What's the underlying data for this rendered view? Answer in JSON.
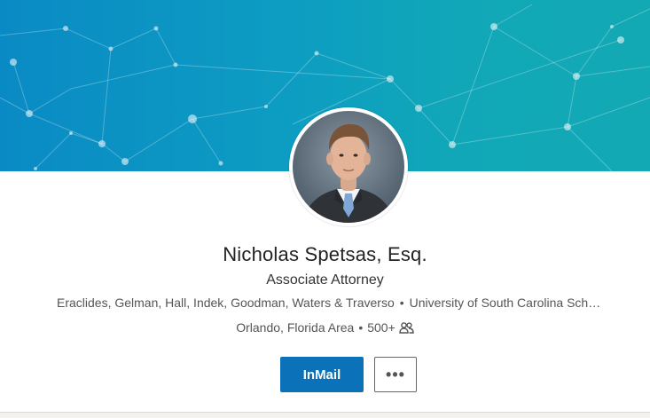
{
  "profile": {
    "name": "Nicholas Spetsas, Esq.",
    "headline": "Associate Attorney",
    "company": "Eraclides, Gelman, Hall, Indek, Goodman, Waters & Traverso",
    "school": "University of South Carolina School of Law",
    "location": "Orlando, Florida Area",
    "connections": "500+"
  },
  "separator": "•",
  "actions": {
    "inmail_label": "InMail",
    "more_label": "•••"
  },
  "icons": {
    "connections": "people-icon",
    "more": "ellipsis-icon"
  },
  "colors": {
    "banner_start": "#0a8ac4",
    "banner_end": "#12a9b4",
    "primary_button": "#0b72b9"
  }
}
